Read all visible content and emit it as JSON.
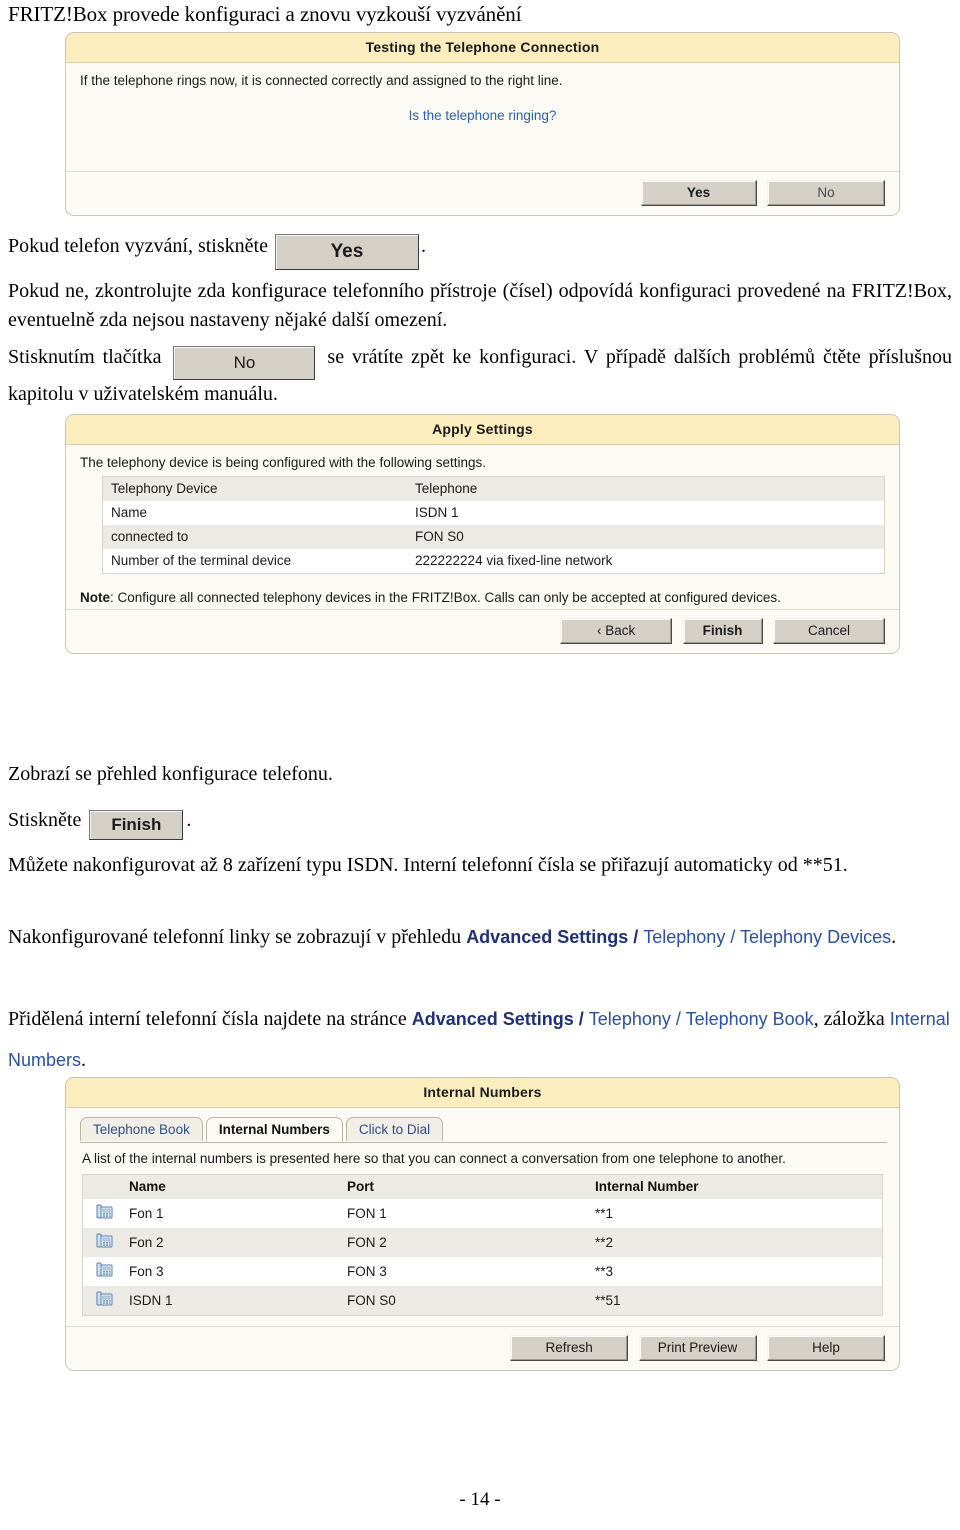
{
  "page": {
    "heading": "FRITZ!Box provede konfiguraci a znovu vyzkouší vyzvánění",
    "footer": "- 14 -"
  },
  "dialog_testing": {
    "title": "Testing the Telephone Connection",
    "body_text": "If the telephone rings now, it is connected correctly and assigned to the right line.",
    "link_text": "Is the telephone ringing?",
    "buttons": {
      "yes": "Yes",
      "no": "No"
    }
  },
  "paragraph_press_yes": {
    "before": "Pokud telefon vyzvání, stiskněte",
    "button": "Yes",
    "after": "."
  },
  "paragraph_check": "Pokud ne,  zkontrolujte zda konfigurace telefonního přístroje (čísel) odpovídá konfiguraci provedené na FRITZ!Box, eventuelně zda nejsou nastaveny nějaké další omezení.",
  "paragraph_press_no": {
    "before": "Stisknutím tlačítka",
    "button": "No",
    "after": "se vrátíte zpět ke konfiguraci. V případě dalších problémů čtěte příslušnou kapitolu v uživatelském manuálu."
  },
  "dialog_apply": {
    "title": "Apply Settings",
    "intro": "The telephony device is being configured with the following settings.",
    "rows": [
      {
        "key": "Telephony Device",
        "value": "Telephone"
      },
      {
        "key": "Name",
        "value": "ISDN 1"
      },
      {
        "key": "connected to",
        "value": "FON S0"
      },
      {
        "key": "Number of the terminal device",
        "value": "222222224 via fixed-line network"
      }
    ],
    "note_label": "Note",
    "note_text": ": Configure all connected telephony devices in the FRITZ!Box. Calls can only be accepted at configured devices.",
    "buttons": {
      "back": "‹ Back",
      "finish": "Finish",
      "cancel": "Cancel"
    }
  },
  "paragraph_overview": "Zobrazí se přehled konfigurace  telefonu.",
  "paragraph_press_finish": {
    "before": "Stiskněte",
    "button": "Finish",
    "after": "."
  },
  "paragraph_isdn": "Můžete nakonfigurovat až 8 zařízení typu ISDN. Interní telefonní čísla se přiřazují automaticky od **51.",
  "paragraph_devices": {
    "plain1": "Nakonfigurované telefonní linky se zobrazují v přehledu ",
    "bold1": "Advanced Settings",
    "sep1": " / ",
    "reg1": "Telephony",
    "sep2": " / ",
    "reg2": "Telephony Devices",
    "tail": "."
  },
  "paragraph_numbers": {
    "plain1": "Přidělená interní telefonní čísla najdete na stránce  ",
    "bold1": "Advanced Settings",
    "sep1": " / ",
    "reg1": "Telephony",
    "sep2": " / ",
    "reg2": "Telephony Book",
    "mid": ", záložka ",
    "reg3": "Internal Numbers",
    "tail": "."
  },
  "dialog_internal": {
    "title": "Internal Numbers",
    "tabs": [
      {
        "label": "Telephone Book",
        "active": false
      },
      {
        "label": "Internal Numbers",
        "active": true
      },
      {
        "label": "Click to Dial",
        "active": false
      }
    ],
    "intro": "A list of the internal numbers is presented here so that you can connect a conversation from one telephone to another.",
    "columns": [
      "",
      "Name",
      "Port",
      "Internal Number"
    ],
    "rows": [
      {
        "icon": "telephone-icon",
        "name": "Fon 1",
        "port": "FON 1",
        "number": "**1"
      },
      {
        "icon": "telephone-icon",
        "name": "Fon 2",
        "port": "FON 2",
        "number": "**2"
      },
      {
        "icon": "telephone-icon",
        "name": "Fon 3",
        "port": "FON 3",
        "number": "**3"
      },
      {
        "icon": "telephone-icon",
        "name": "ISDN 1",
        "port": "FON S0",
        "number": "**51"
      }
    ],
    "buttons": {
      "refresh": "Refresh",
      "print_preview": "Print Preview",
      "help": "Help"
    }
  },
  "colors": {
    "dialog_header": "#fbedbe",
    "dialog_body": "#fbfaf5",
    "link_blue": "#2d63a8",
    "accent_blue_bold": "#1f2f7a",
    "accent_blue": "#2b4fa2",
    "button_face": "#d4d0c8",
    "table_stripe": "#eceae4"
  }
}
